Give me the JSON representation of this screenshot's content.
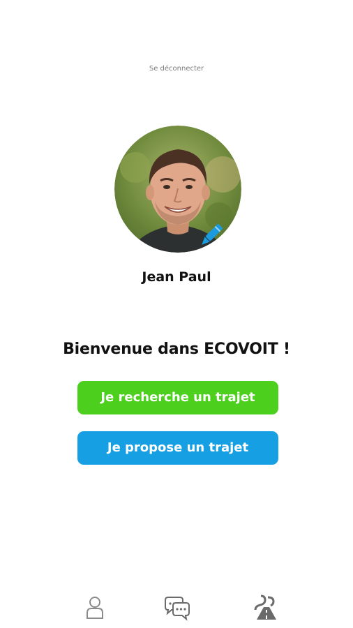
{
  "header": {
    "logout_label": "Se déconnecter"
  },
  "profile": {
    "name": "Jean Paul",
    "avatar_icon": "profile-photo",
    "edit_icon": "pencil-icon"
  },
  "main": {
    "welcome_text": "Bienvenue dans ECOVOIT !",
    "search_button_label": "Je recherche un trajet",
    "offer_button_label": "Je propose un trajet"
  },
  "tabbar": {
    "items": [
      {
        "icon": "user-icon"
      },
      {
        "icon": "chat-bubbles-icon"
      },
      {
        "icon": "road-icon"
      }
    ]
  },
  "colors": {
    "search_button": "#4ccf1d",
    "offer_button": "#16a0e3",
    "edit_pencil": "#1a9be0",
    "text": "#111111"
  }
}
